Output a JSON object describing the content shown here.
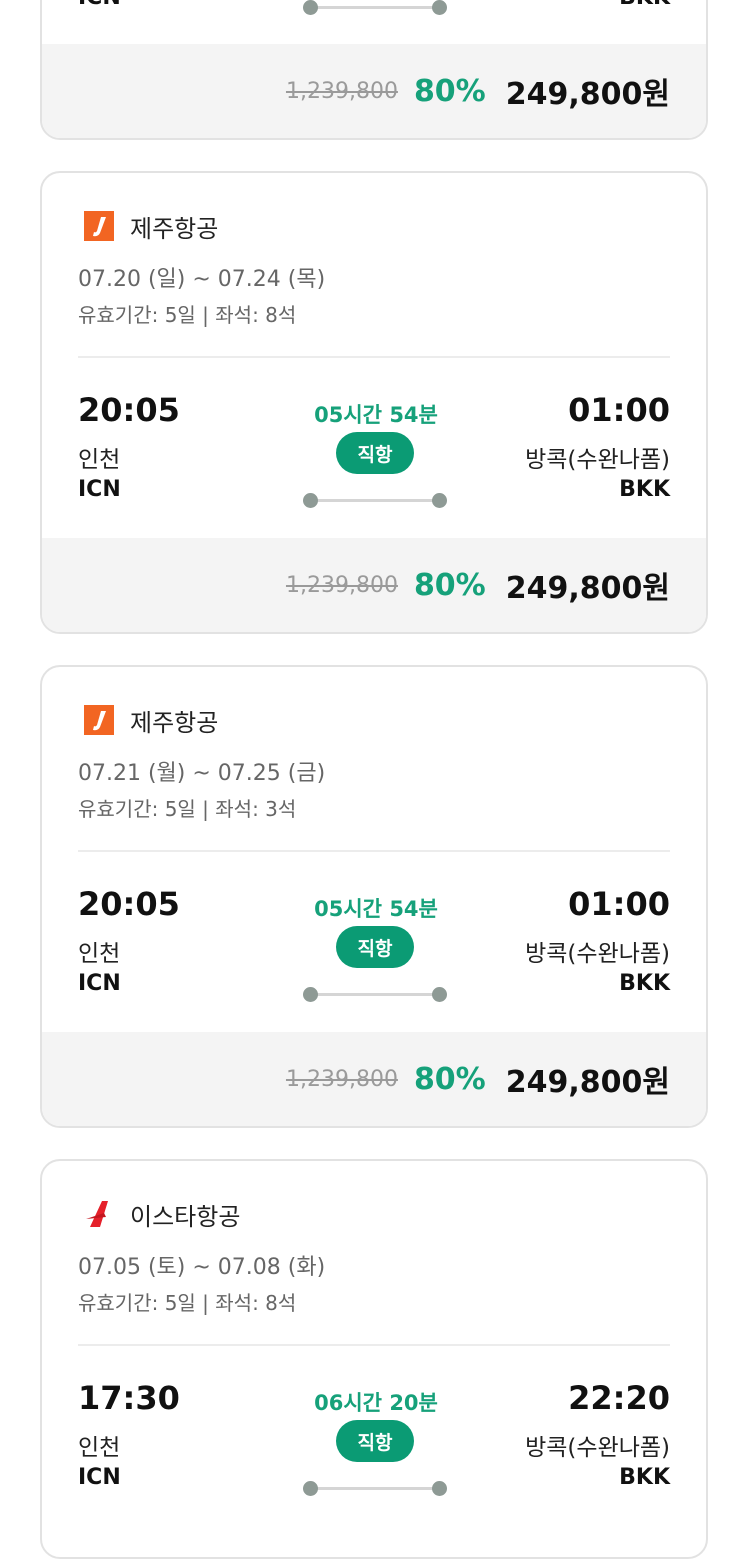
{
  "currency_suffix": "원",
  "top_card": {
    "dep_code": "ICN",
    "arr_code": "BKK",
    "original_price": "1,239,800",
    "discount": "80%",
    "final_price": "249,800원"
  },
  "cards": [
    {
      "airline": "제주항공",
      "logo": "jeju-air-logo",
      "dates": "07.20 (일) ~ 07.24 (목)",
      "meta": "유효기간: 5일 | 좌석: 8석",
      "dep_time": "20:05",
      "dep_city": "인천",
      "dep_code": "ICN",
      "duration": "05시간 54분",
      "direct": "직항",
      "arr_time": "01:00",
      "arr_city": "방콕(수완나폼)",
      "arr_code": "BKK",
      "original_price": "1,239,800",
      "discount": "80%",
      "final_price": "249,800원"
    },
    {
      "airline": "제주항공",
      "logo": "jeju-air-logo",
      "dates": "07.21 (월) ~ 07.25 (금)",
      "meta": "유효기간: 5일 | 좌석: 3석",
      "dep_time": "20:05",
      "dep_city": "인천",
      "dep_code": "ICN",
      "duration": "05시간 54분",
      "direct": "직항",
      "arr_time": "01:00",
      "arr_city": "방콕(수완나폼)",
      "arr_code": "BKK",
      "original_price": "1,239,800",
      "discount": "80%",
      "final_price": "249,800원"
    },
    {
      "airline": "이스타항공",
      "logo": "eastar-jet-logo",
      "dates": "07.05 (토) ~ 07.08 (화)",
      "meta": "유효기간: 5일 | 좌석: 8석",
      "dep_time": "17:30",
      "dep_city": "인천",
      "dep_code": "ICN",
      "duration": "06시간 20분",
      "direct": "직항",
      "arr_time": "22:20",
      "arr_city": "방콕(수완나폼)",
      "arr_code": "BKK"
    }
  ],
  "colors": {
    "accent_green": "#16a17a",
    "badge_green": "#0b9b74",
    "jeju_orange": "#f26522",
    "eastar_red": "#e5202a"
  }
}
